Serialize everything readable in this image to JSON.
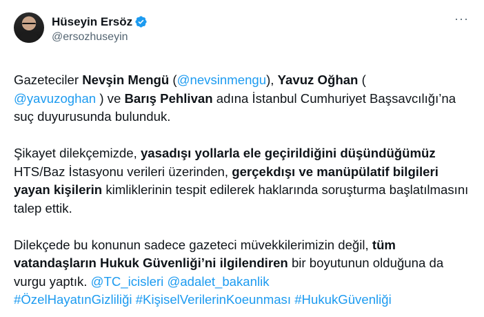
{
  "author": {
    "display_name": "Hüseyin Ersöz",
    "handle": "@ersozhuseyin",
    "verified_icon": "verified-badge-icon",
    "accent_color": "#1d9bf0"
  },
  "menu": {
    "more_label": "···"
  },
  "tweet": {
    "p1": {
      "t1": "Gazeteciler ",
      "b1": "Nevşin Mengü",
      "t2": " (",
      "l1": "@nevsinmengu",
      "t3": "), ",
      "b2": "Yavuz Oğhan",
      "t4": " (",
      "l2": "@yavuzoghan",
      "t5": " ) ve ",
      "b3": "Barış Pehlivan",
      "t6": " adına İstanbul Cumhuriyet Başsavcılığı’na suç duyurusunda bulunduk."
    },
    "p2": {
      "t1": "Şikayet dilekçemizde, ",
      "b1": "yasadışı yollarla ele geçirildiğini düşündüğümüz",
      "t2": " HTS/Baz İstasyonu verileri üzerinden, ",
      "b2": "gerçekdışı ve manüpülatif bilgileri yayan kişilerin",
      "t3": " kimliklerinin tespit edilerek haklarında soruşturma başlatılmasını talep ettik."
    },
    "p3": {
      "t1": "Dilekçede bu konunun sadece gazeteci müvekkilerimizin değil, ",
      "b1": "tüm vatandaşların Hukuk Güvenliği’ni ilgilendiren",
      "t2": " bir boyutunun olduğuna da vurgu yaptık. ",
      "l1": "@TC_icisleri",
      "l2": "@adalet_bakanlik",
      "h1": "#ÖzelHayatınGizliliği",
      "h2": "#KişiselVerilerinKoeunması",
      "h3": "#HukukGüvenliği"
    }
  }
}
